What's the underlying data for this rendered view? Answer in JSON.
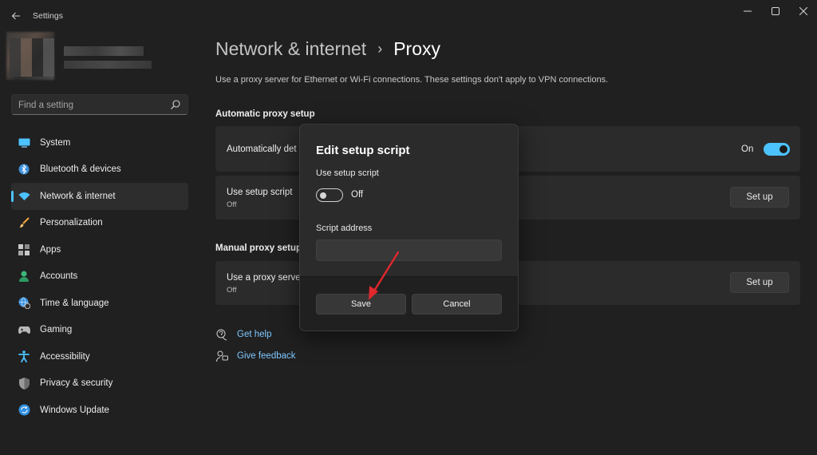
{
  "window": {
    "title": "Settings",
    "back_icon": "back-arrow-icon",
    "controls": [
      "minimize-icon",
      "maximize-icon",
      "close-icon"
    ]
  },
  "search": {
    "placeholder": "Find a setting",
    "value": ""
  },
  "sidebar": {
    "items": [
      {
        "label": "System",
        "icon": "monitor-icon",
        "active": false
      },
      {
        "label": "Bluetooth & devices",
        "icon": "bluetooth-icon",
        "active": false
      },
      {
        "label": "Network & internet",
        "icon": "wifi-icon",
        "active": true
      },
      {
        "label": "Personalization",
        "icon": "brush-icon",
        "active": false
      },
      {
        "label": "Apps",
        "icon": "apps-icon",
        "active": false
      },
      {
        "label": "Accounts",
        "icon": "person-icon",
        "active": false
      },
      {
        "label": "Time & language",
        "icon": "globe-clock-icon",
        "active": false
      },
      {
        "label": "Gaming",
        "icon": "gamepad-icon",
        "active": false
      },
      {
        "label": "Accessibility",
        "icon": "accessibility-icon",
        "active": false
      },
      {
        "label": "Privacy & security",
        "icon": "shield-icon",
        "active": false
      },
      {
        "label": "Windows Update",
        "icon": "update-icon",
        "active": false
      }
    ]
  },
  "breadcrumb": {
    "parent": "Network & internet",
    "separator": "›",
    "current": "Proxy"
  },
  "description": "Use a proxy server for Ethernet or Wi-Fi connections. These settings don't apply to VPN connections.",
  "automatic": {
    "section_title": "Automatic proxy setup",
    "detect_label": "Automatically det",
    "detect_state": "On",
    "script_label": "Use setup script",
    "script_state": "Off",
    "setup_button": "Set up"
  },
  "manual": {
    "section_title": "Manual proxy setup",
    "proxy_label": "Use a proxy server",
    "proxy_state": "Off",
    "setup_button": "Set up"
  },
  "help": {
    "get_help": "Get help",
    "feedback": "Give feedback"
  },
  "dialog": {
    "title": "Edit setup script",
    "toggle_label": "Use setup script",
    "toggle_state": "Off",
    "address_label": "Script address",
    "address_value": "",
    "save": "Save",
    "cancel": "Cancel"
  },
  "colors": {
    "accent": "#4cc2ff",
    "background": "#202020",
    "card": "#2b2b2b",
    "annotation_arrow": "#e0282d"
  }
}
